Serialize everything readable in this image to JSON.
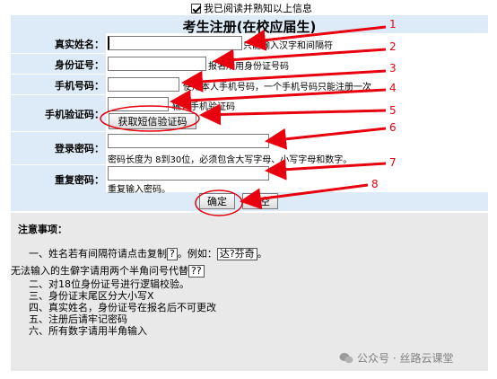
{
  "agreement": {
    "label": "我已阅读并熟知以上信息",
    "checked": true
  },
  "form": {
    "title": "考生注册(在校应届生)",
    "name": {
      "label": "真实姓名：",
      "value": "",
      "hint": "只能输入汉字和间隔符"
    },
    "idcard": {
      "label": "身份证号：",
      "value": "",
      "hint": "报名所用身份证号码"
    },
    "phone": {
      "label": "手机号码：",
      "value": "",
      "hint": "使用本人手机号码，一个手机号码只能注册一次"
    },
    "sms": {
      "label": "手机验证码：",
      "value": "",
      "hint": "输入手机验证码",
      "button": "获取短信验证码"
    },
    "password": {
      "label": "登录密码：",
      "value": "",
      "hint": "密码长度为 8到30位，必须包含大写字母、小写字母和数字。"
    },
    "repeat": {
      "label": "重复密码：",
      "value": "",
      "hint": "重复输入密码。"
    },
    "confirm_label": "确定",
    "clear_label": "清空"
  },
  "notice": {
    "heading": "注意事项：",
    "line1_a": "一、姓名若有间隔符请点击复制",
    "line1_box": "?",
    "line1_b": "。例如：",
    "line1_example": "达?芬奇",
    "line1_c": "。",
    "line2_a": "无法输入的生僻字请用两个半角问号代替",
    "line2_box": "??",
    "line3": "二、对18位身份证号进行逻辑校验。",
    "line4": "三、身份证末尾区分大小写X",
    "line5": "四、真实姓名，身份证号在报名后不可更改",
    "line6": "五、注册后请牢记密码",
    "line7": "六、所有数字请用半角输入"
  },
  "watermark": "公众号 · 丝路云课堂",
  "annotations": [
    "1",
    "2",
    "3",
    "4",
    "5",
    "6",
    "7",
    "8"
  ],
  "colors": {
    "form_bg": "#dcebf7",
    "notice_bg": "#e9e9e9",
    "annotation": "#e8000e"
  }
}
